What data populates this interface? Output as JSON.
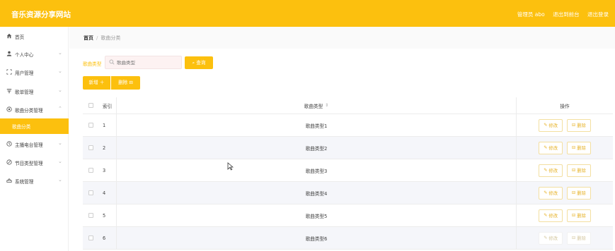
{
  "header": {
    "app_title": "音乐资源分享网站",
    "admin_label": "管理员 abo",
    "back_label": "退出到前台",
    "logout_label": "退出登录"
  },
  "sidebar": {
    "items": [
      {
        "label": "首页",
        "icon": "home-icon",
        "arrow": false
      },
      {
        "label": "个人中心",
        "icon": "user-icon",
        "arrow": true
      },
      {
        "label": "用户管理",
        "icon": "users-icon",
        "arrow": true
      },
      {
        "label": "歌单管理",
        "icon": "playlist-icon",
        "arrow": true
      },
      {
        "label": "歌曲分类管理",
        "icon": "category-icon",
        "arrow": true
      },
      {
        "label": "歌曲分类",
        "icon": "",
        "arrow": false,
        "active": true
      },
      {
        "label": "主播电台管理",
        "icon": "radio-icon",
        "arrow": true
      },
      {
        "label": "节目类型管理",
        "icon": "program-icon",
        "arrow": true
      },
      {
        "label": "系统管理",
        "icon": "system-icon",
        "arrow": true
      }
    ]
  },
  "breadcrumb": {
    "home": "首页",
    "separator": "/",
    "current": "歌曲分类"
  },
  "filter": {
    "label": "歌曲类型",
    "placeholder": "歌曲类型",
    "query_label": "查询"
  },
  "actions": {
    "add_label": "新增 ＋",
    "delete_label": "删除 ⊟"
  },
  "table": {
    "headers": {
      "index": "索引",
      "type": "歌曲类型",
      "ops": "操作"
    },
    "edit_label": "修改",
    "delete_label": "删除",
    "rows": [
      {
        "index": "1",
        "type": "歌曲类型1"
      },
      {
        "index": "2",
        "type": "歌曲类型2"
      },
      {
        "index": "3",
        "type": "歌曲类型3"
      },
      {
        "index": "4",
        "type": "歌曲类型4"
      },
      {
        "index": "5",
        "type": "歌曲类型5"
      },
      {
        "index": "6",
        "type": "歌曲类型6"
      }
    ]
  },
  "colors": {
    "accent": "#fcc00e",
    "stripe": "#f5f6fa"
  }
}
